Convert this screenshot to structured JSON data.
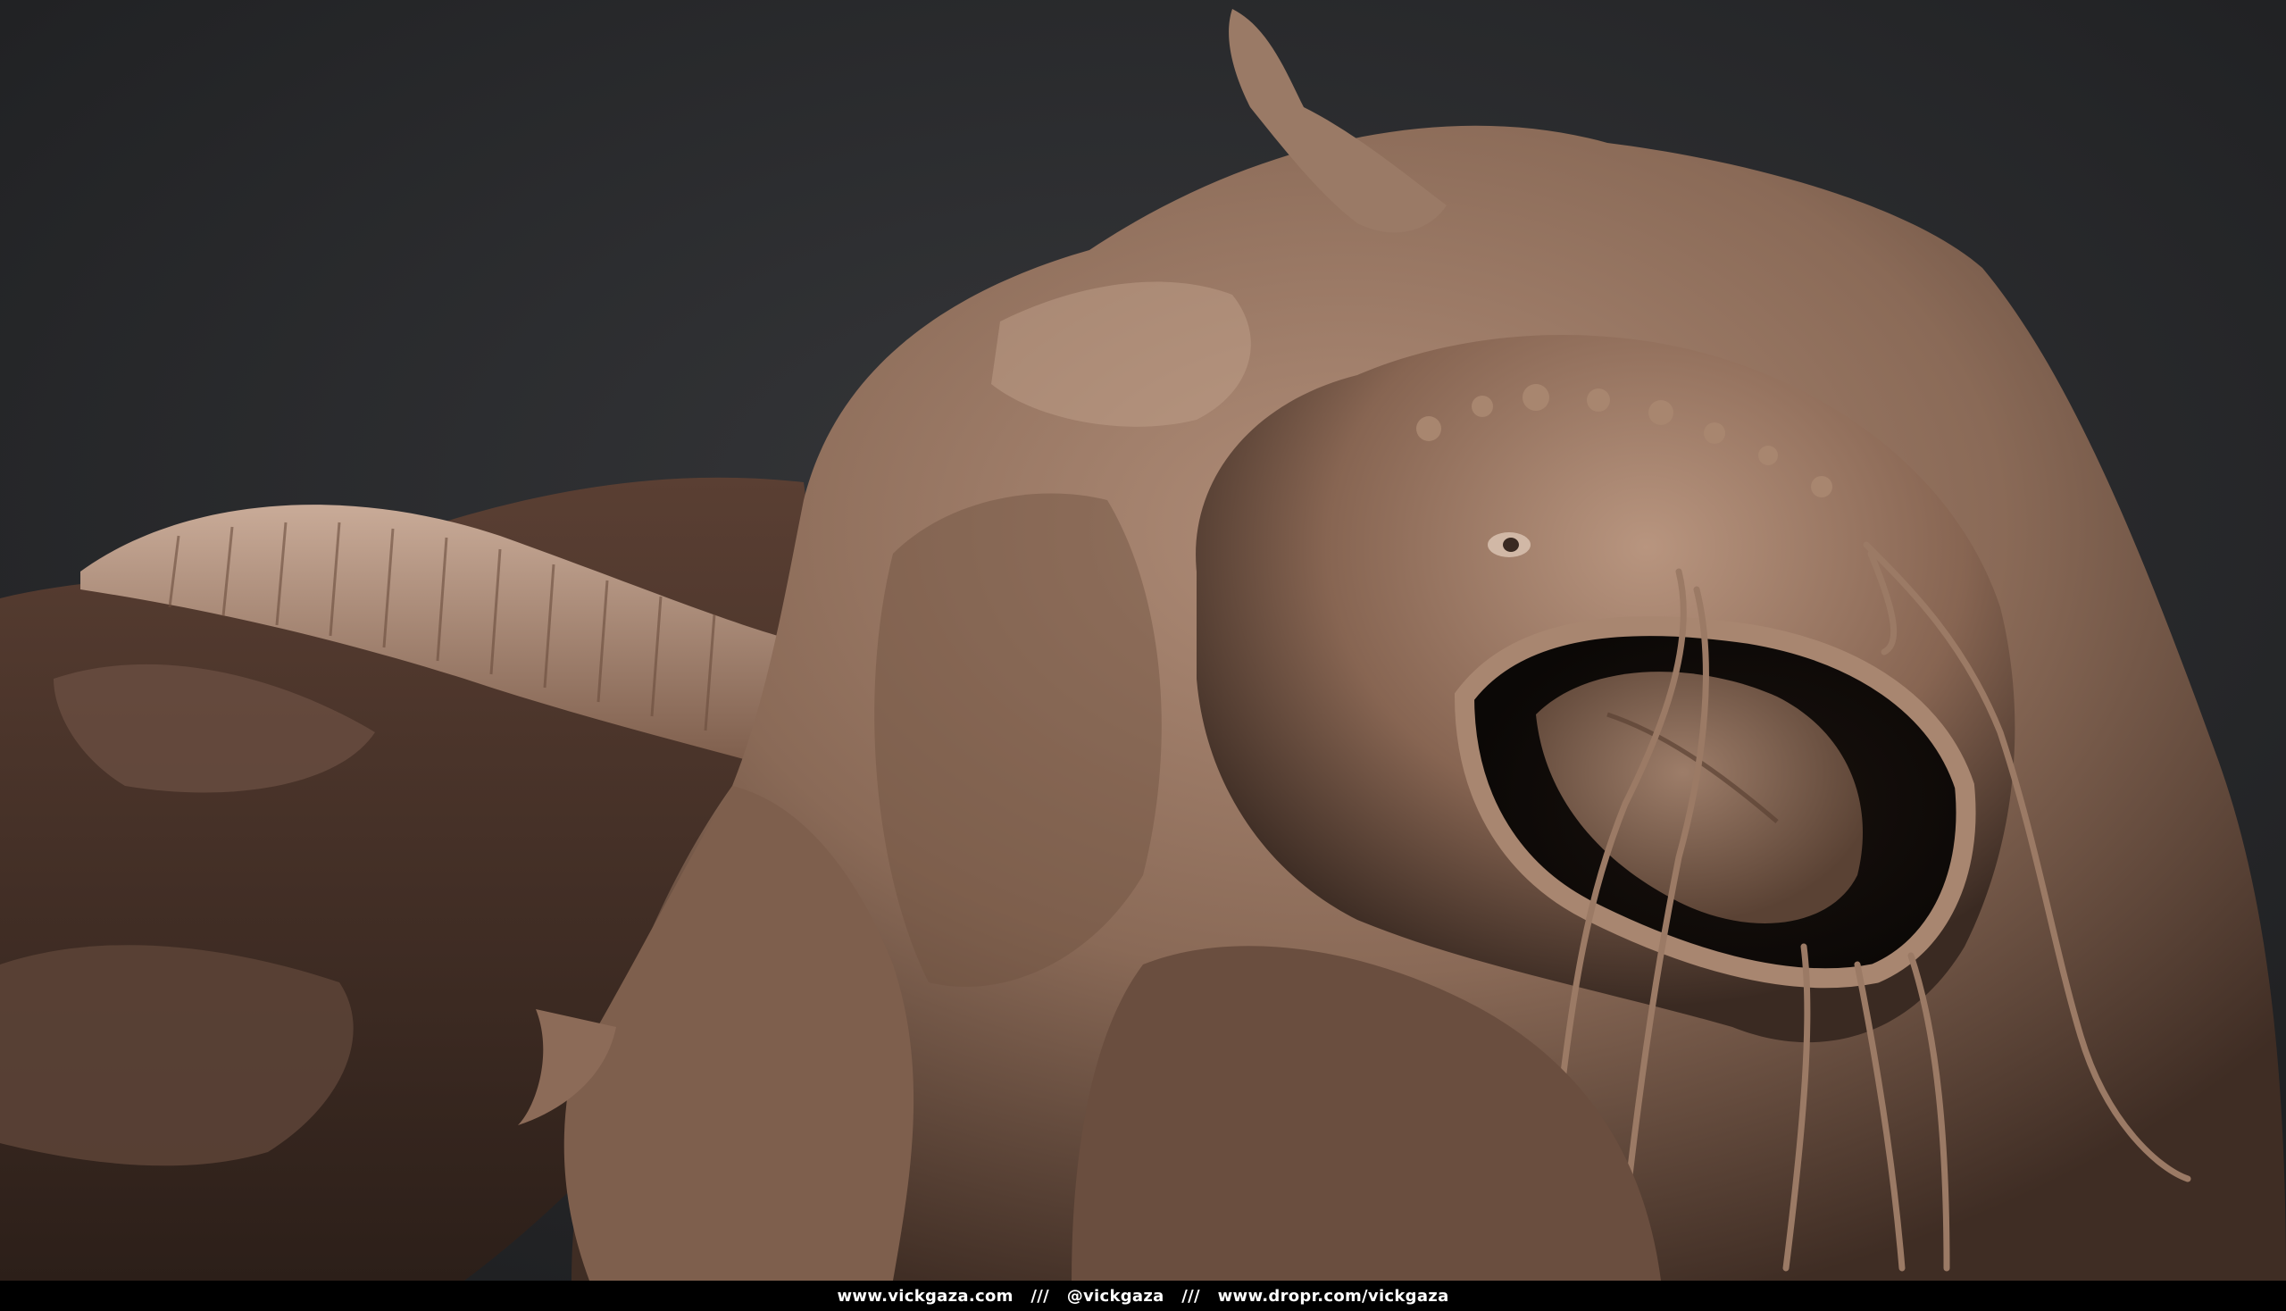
{
  "footer": {
    "credits": "www.vickgaza.com   ///   @vickgaza   ///   www.dropr.com/vickgaza"
  },
  "scene": {
    "subject": "creature-sculpt",
    "background_color": "#2b2c2f",
    "clay_color": "#8a6a57",
    "clay_shadow_color": "#3a2a22",
    "clay_highlight_color": "#c7a896",
    "rock_color": "#4a352c"
  }
}
